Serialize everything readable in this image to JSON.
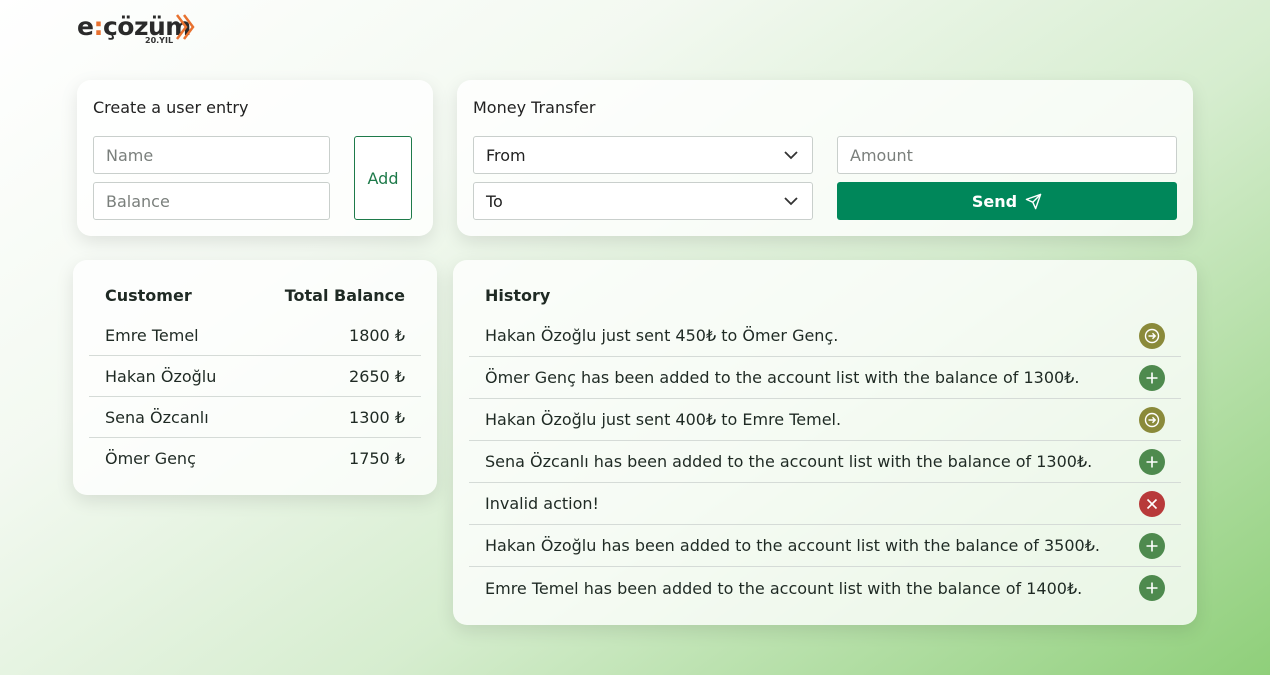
{
  "logo": {
    "brand_left": "e",
    "brand_dot": ":",
    "brand_right": "çözüm",
    "sub": "20.YIL"
  },
  "user_entry": {
    "title": "Create a user entry",
    "name_placeholder": "Name",
    "balance_placeholder": "Balance",
    "add_label": "Add"
  },
  "transfer": {
    "title": "Money Transfer",
    "from_label": "From",
    "to_label": "To",
    "amount_placeholder": "Amount",
    "send_label": "Send"
  },
  "customers": {
    "col_customer": "Customer",
    "col_balance": "Total Balance",
    "rows": [
      {
        "name": "Emre Temel",
        "balance": "1800 ₺"
      },
      {
        "name": "Hakan Özoğlu",
        "balance": "2650 ₺"
      },
      {
        "name": "Sena Özcanlı",
        "balance": "1300 ₺"
      },
      {
        "name": "Ömer Genç",
        "balance": "1750 ₺"
      }
    ]
  },
  "history": {
    "title": "History",
    "items": [
      {
        "text": "Hakan Özoğlu just sent 450₺ to Ömer Genç.",
        "icon": "arrow-right-icon",
        "color": "#8a8a3a"
      },
      {
        "text": "Ömer Genç has been added to the account list with the balance of 1300₺.",
        "icon": "plus-icon",
        "color": "#4e8a4e"
      },
      {
        "text": "Hakan Özoğlu just sent 400₺ to Emre Temel.",
        "icon": "arrow-right-icon",
        "color": "#8a8a3a"
      },
      {
        "text": "Sena Özcanlı has been added to the account list with the balance of 1300₺.",
        "icon": "plus-icon",
        "color": "#4e8a4e"
      },
      {
        "text": "Invalid action!",
        "icon": "close-icon",
        "color": "#b83a3a"
      },
      {
        "text": "Hakan Özoğlu has been added to the account list with the balance of 3500₺.",
        "icon": "plus-icon",
        "color": "#4e8a4e"
      },
      {
        "text": "Emre Temel has been added to the account list with the balance of 1400₺.",
        "icon": "plus-icon",
        "color": "#4e8a4e"
      }
    ]
  },
  "colors": {
    "accent": "#00875a",
    "add_border": "#1e7a4a",
    "logo_orange": "#e8712f"
  }
}
